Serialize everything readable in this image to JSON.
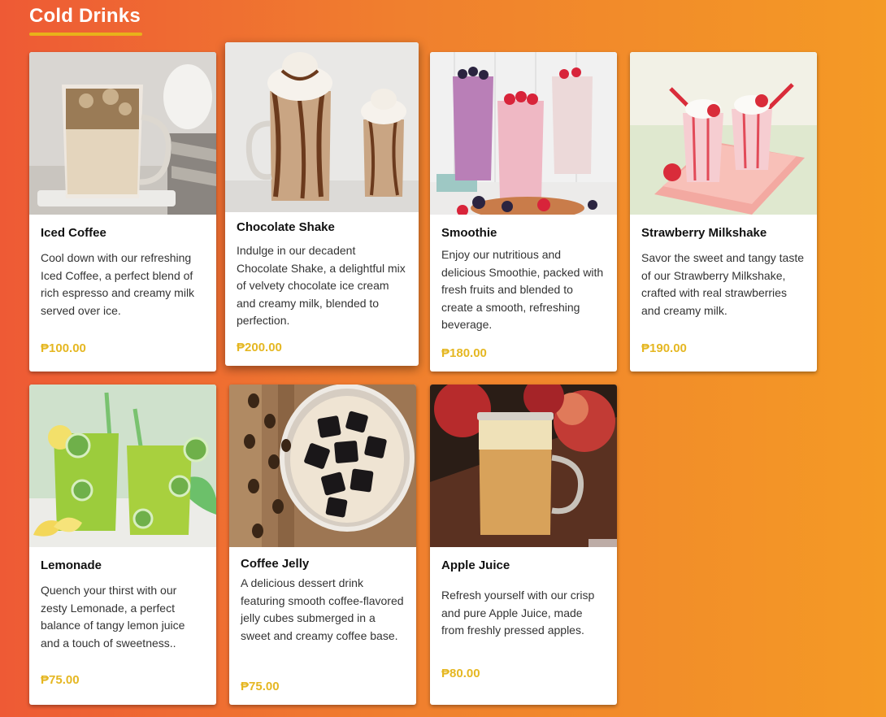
{
  "section": {
    "title": "Cold Drinks"
  },
  "colors": {
    "accent": "#e8b21a",
    "price": "#e5b722"
  },
  "cards": [
    {
      "name": "Iced Coffee",
      "description": "Cool down with our refreshing Iced Coffee, a perfect blend of rich espresso and creamy milk served over ice.",
      "price": "₱100.00",
      "image": "iced-coffee-image"
    },
    {
      "name": "Chocolate Shake",
      "description": "Indulge in our decadent Chocolate Shake, a delightful mix of velvety chocolate ice cream and creamy milk, blended to perfection.",
      "price": "₱200.00",
      "image": "chocolate-shake-image"
    },
    {
      "name": "Smoothie",
      "description": "Enjoy our nutritious and delicious Smoothie, packed with fresh fruits and blended to create a smooth, refreshing beverage.",
      "price": "₱180.00",
      "image": "smoothie-image"
    },
    {
      "name": "Strawberry Milkshake",
      "description": "Savor the sweet and tangy taste of our Strawberry Milkshake, crafted with real strawberries and creamy milk.",
      "price": "₱190.00",
      "image": "strawberry-milkshake-image"
    },
    {
      "name": "Lemonade",
      "description": "Quench your thirst with our zesty Lemonade, a perfect balance of tangy lemon juice and a touch of sweetness..",
      "price": "₱75.00",
      "image": "lemonade-image"
    },
    {
      "name": "Coffee Jelly",
      "description": "A delicious dessert drink featuring smooth coffee-flavored jelly cubes submerged in a sweet and creamy coffee base.",
      "price": "₱75.00",
      "image": "coffee-jelly-image"
    },
    {
      "name": "Apple Juice",
      "description": "Refresh yourself with our crisp and pure Apple Juice, made from freshly pressed apples.",
      "price": "₱80.00",
      "image": "apple-juice-image"
    }
  ]
}
